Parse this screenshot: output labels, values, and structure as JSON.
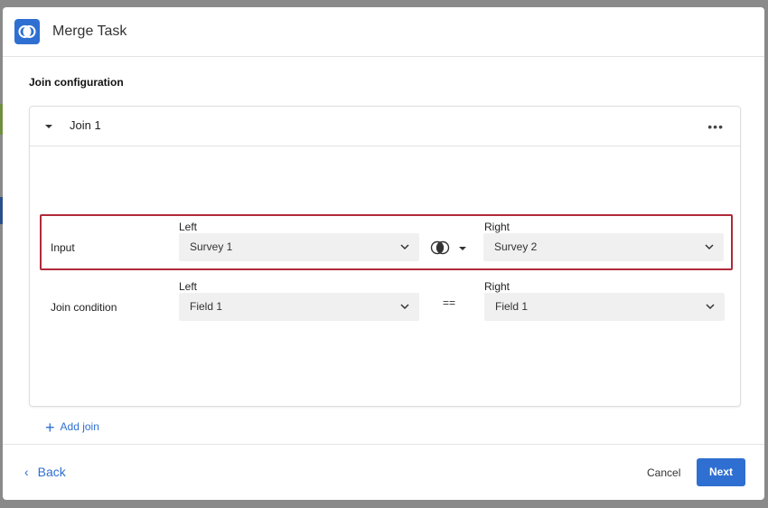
{
  "dialog": {
    "title": "Merge Task",
    "section_label": "Join configuration"
  },
  "join": {
    "title": "Join 1",
    "more_icon": "ellipsis-icon",
    "input": {
      "label": "Input",
      "left_label": "Left",
      "left_value": "Survey 1",
      "right_label": "Right",
      "right_value": "Survey 2",
      "join_type_icon": "venn-inner-join-icon"
    },
    "condition": {
      "label": "Join condition",
      "left_label": "Left",
      "left_value": "Field 1",
      "operator": "==",
      "right_label": "Right",
      "right_value": "Field 1"
    }
  },
  "add_join_label": "Add join",
  "footer": {
    "back_label": "Back",
    "cancel_label": "Cancel",
    "next_label": "Next"
  },
  "colors": {
    "accent": "#2f6fd1",
    "highlight_border": "#b02a3a"
  }
}
